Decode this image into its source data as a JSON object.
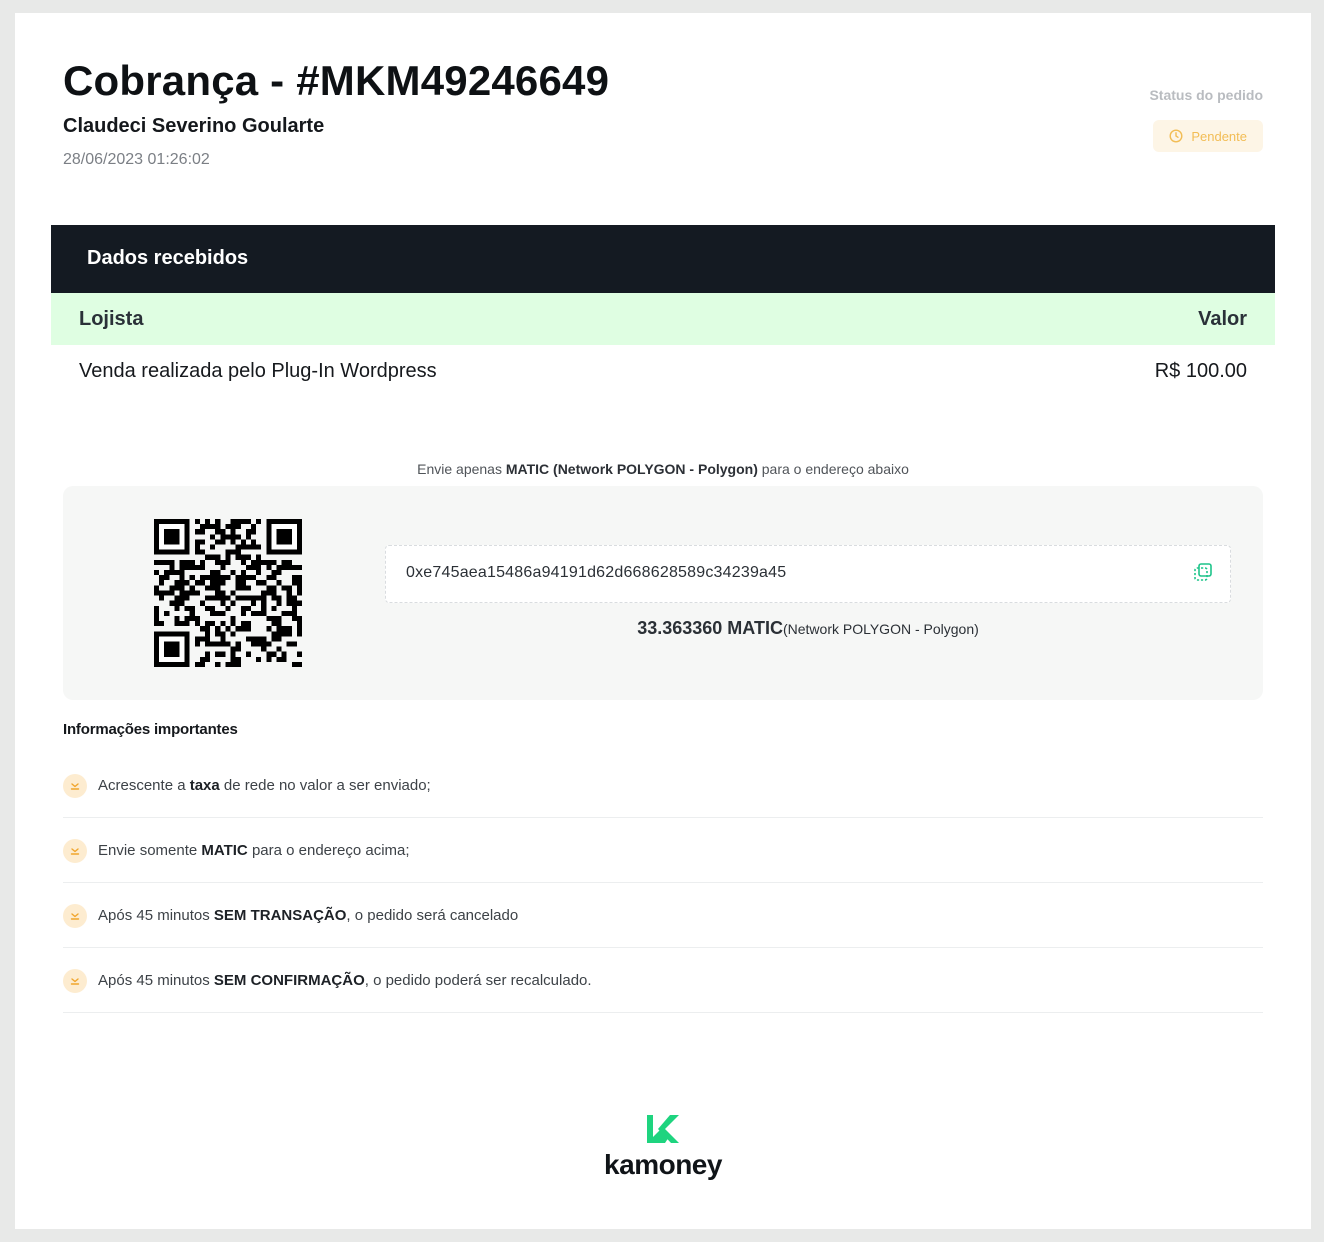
{
  "header": {
    "title": "Cobrança - #MKM49246649",
    "customer": "Claudeci Severino Goularte",
    "datetime": "28/06/2023 01:26:02",
    "status_label": "Status do pedido",
    "status_value": "Pendente",
    "status_icon": "clock-icon",
    "status_color": "#f2bd55"
  },
  "data_section": {
    "heading": "Dados recebidos",
    "columns": [
      "Lojista",
      "Valor"
    ],
    "rows": [
      {
        "merchant": "Venda realizada pelo Plug-In Wordpress",
        "value": "R$ 100.00"
      }
    ]
  },
  "payment": {
    "instruction_pre": "Envie apenas",
    "instruction_bold": "MATIC (Network POLYGON - Polygon)",
    "instruction_post": "para o endereço abaixo",
    "address": "0xe745aea15486a94191d62d668628589c34239a45",
    "copy_icon": "copy-icon",
    "amount": "33.363360 MATIC",
    "network": "(Network POLYGON - Polygon)"
  },
  "info": {
    "title": "Informações importantes",
    "items": [
      {
        "pre": "Acrescente a ",
        "bold": "taxa",
        "post": " de rede no valor a ser enviado;"
      },
      {
        "pre": "Envie somente ",
        "bold": "MATIC",
        "post": " para o endereço acima;"
      },
      {
        "pre": "Após 45 minutos ",
        "bold": "SEM TRANSAÇÃO",
        "post": ", o pedido será cancelado"
      },
      {
        "pre": "Após 45 minutos ",
        "bold": "SEM CONFIRMAÇÃO",
        "post": ", o pedido poderá ser recalculado."
      }
    ]
  },
  "footer": {
    "brand": "kamoney",
    "brand_color": "#1ed47f"
  }
}
